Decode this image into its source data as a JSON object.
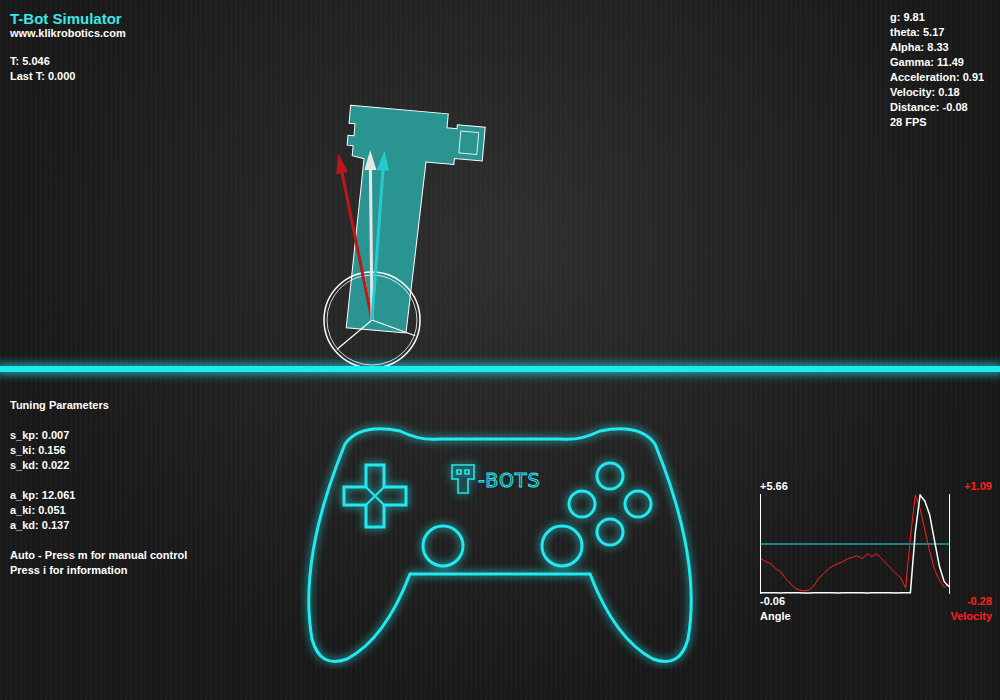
{
  "header": {
    "title": "T-Bot Simulator",
    "url": "www.klikrobotics.com",
    "time": "T: 5.046",
    "last_time": "Last T: 0.000"
  },
  "stats": [
    "g: 9.81",
    "theta: 5.17",
    "Alpha: 8.33",
    "Gamma: 11.49",
    "Acceleration: 0.91",
    "Velocity: 0.18",
    "Distance: -0.08",
    "28 FPS"
  ],
  "robot": {
    "tilt": 5,
    "arrows": [
      {
        "name": "red",
        "color": "#c0161b",
        "angle": -11.49
      },
      {
        "name": "white",
        "color": "#e6e6e6",
        "angle": -0.6
      },
      {
        "name": "cyan",
        "color": "#27c8d0",
        "angle": 4.2
      }
    ]
  },
  "tuning": {
    "title": "Tuning Parameters",
    "groups": [
      [
        "s_kp: 0.007",
        "s_ki: 0.156",
        "s_kd: 0.022"
      ],
      [
        "a_kp: 12.061",
        "a_ki: 0.051",
        "a_kd: 0.137"
      ]
    ],
    "footer": [
      "Auto - Press m for manual control",
      "Press i for information"
    ]
  },
  "controller": {
    "logo": "-BOTS"
  },
  "chart": {
    "series": [
      {
        "label": "Angle",
        "max": "+5.66",
        "min": "-0.06",
        "color": "#ffffff",
        "values": [
          -0.05,
          -0.05,
          -0.04,
          -0.05,
          -0.06,
          -0.05,
          -0.05,
          -0.04,
          -0.05,
          -0.06,
          -0.06,
          -0.05,
          -0.05,
          -0.04,
          -0.05,
          -0.05,
          -0.06,
          -0.05,
          -0.05,
          -0.04,
          -0.05,
          -0.05,
          -0.06,
          -0.05,
          -0.05,
          -0.04,
          -0.05,
          -0.05,
          -0.06,
          -0.05,
          -0.05,
          -0.05,
          3.5,
          5.66,
          5.3,
          4.5,
          3.0,
          1.5,
          0.6,
          0.3
        ]
      },
      {
        "label": "Velocity",
        "max": "+1.09",
        "min": "-0.28",
        "color": "#ff2020",
        "values": [
          0.2,
          0.16,
          0.13,
          0.06,
          0.02,
          -0.07,
          -0.14,
          -0.21,
          -0.24,
          -0.25,
          -0.24,
          -0.18,
          -0.07,
          -0.01,
          0.06,
          0.1,
          0.13,
          0.16,
          0.2,
          0.22,
          0.24,
          0.2,
          0.27,
          0.23,
          0.27,
          0.2,
          0.13,
          0.06,
          -0.01,
          -0.07,
          -0.21,
          0.5,
          1.09,
          0.9,
          0.6,
          0.3,
          0.05,
          -0.1,
          -0.2,
          -0.15
        ]
      }
    ]
  }
}
